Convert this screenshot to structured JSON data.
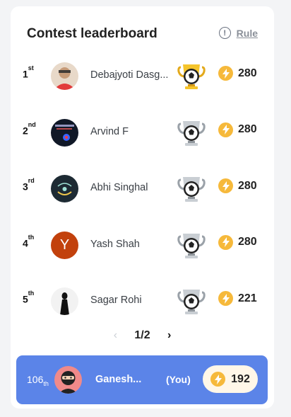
{
  "header": {
    "title": "Contest leaderboard",
    "rule_label": "Rule",
    "info_glyph": "!"
  },
  "leaders": [
    {
      "rank": "1",
      "suffix": "st",
      "name": "Debajyoti Dasg...",
      "points": "280",
      "trophy": "gold-trophy-icon",
      "avatar": "photo"
    },
    {
      "rank": "2",
      "suffix": "nd",
      "name": "Arvind F",
      "points": "280",
      "trophy": "silver-trophy-icon",
      "avatar": "dark-art"
    },
    {
      "rank": "3",
      "suffix": "rd",
      "name": "Abhi Singhal",
      "points": "280",
      "trophy": "silver-trophy-icon",
      "avatar": "dark-logo"
    },
    {
      "rank": "4",
      "suffix": "th",
      "name": "Yash Shah",
      "points": "280",
      "trophy": "silver-trophy-icon",
      "avatar": "letter",
      "letter": "Y"
    },
    {
      "rank": "5",
      "suffix": "th",
      "name": "Sagar Rohi",
      "points": "221",
      "trophy": "silver-trophy-icon",
      "avatar": "figure"
    }
  ],
  "pagination": {
    "current": "1/2",
    "prev": "‹",
    "next": "›"
  },
  "you": {
    "rank": "106",
    "suffix": "th",
    "name": "Ganesh...",
    "tag": "(You)",
    "points": "192"
  },
  "colors": {
    "you_bar": "#5b84e8",
    "bolt": "#f6b93b",
    "letter_avatar": "#c2410c"
  }
}
